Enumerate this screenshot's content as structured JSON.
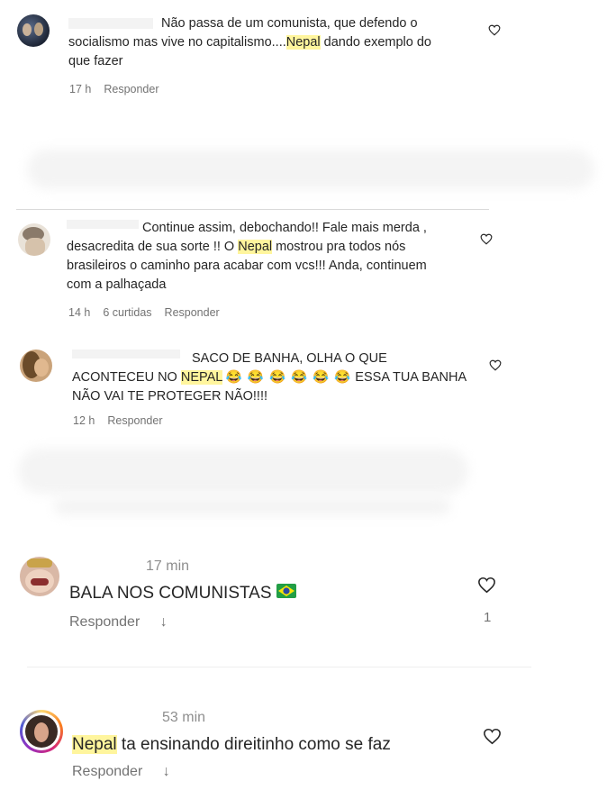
{
  "comments": [
    {
      "text_before": "Não passa de um comunista, que defendo o",
      "line2_before": "socialismo mas vive no capitalismo....",
      "highlight": "Nepal",
      "line2_after": " dando exemplo do",
      "line3": "que fazer",
      "time": "17 h",
      "reply": "Responder"
    },
    {
      "line1": "Continue assim, debochando!! Fale mais merda ,",
      "line2_before": "desacredita de sua sorte !! O ",
      "highlight": "Nepal",
      "line2_after": " mostrou pra todos nós",
      "line3": "brasileiros o caminho para acabar com vcs!!! Anda, continuem",
      "line4": "com a palhaçada",
      "time": "14 h",
      "likes": "6 curtidas",
      "reply": "Responder"
    },
    {
      "line1": "SACO DE BANHA, OLHA O QUE",
      "line2_before": "ACONTECEU NO ",
      "highlight": "NEPAL",
      "emojis": "😂 😂 😂 😂 😂 😂",
      "line2_after": " ESSA TUA BANHA",
      "line3": "NÃO VAI TE PROTEGER NÃO!!!!",
      "time": "12 h",
      "reply": "Responder"
    },
    {
      "time": "17 min",
      "text": "BALA NOS COMUNISTAS",
      "reply": "Responder",
      "like_count": "1"
    },
    {
      "time": "53 min",
      "highlight": "Nepal",
      "text_after": " ta ensinando direitinho como se faz",
      "reply": "Responder"
    }
  ],
  "colors": {
    "highlight": "#fff59d",
    "meta": "#737373",
    "text": "#262626"
  }
}
